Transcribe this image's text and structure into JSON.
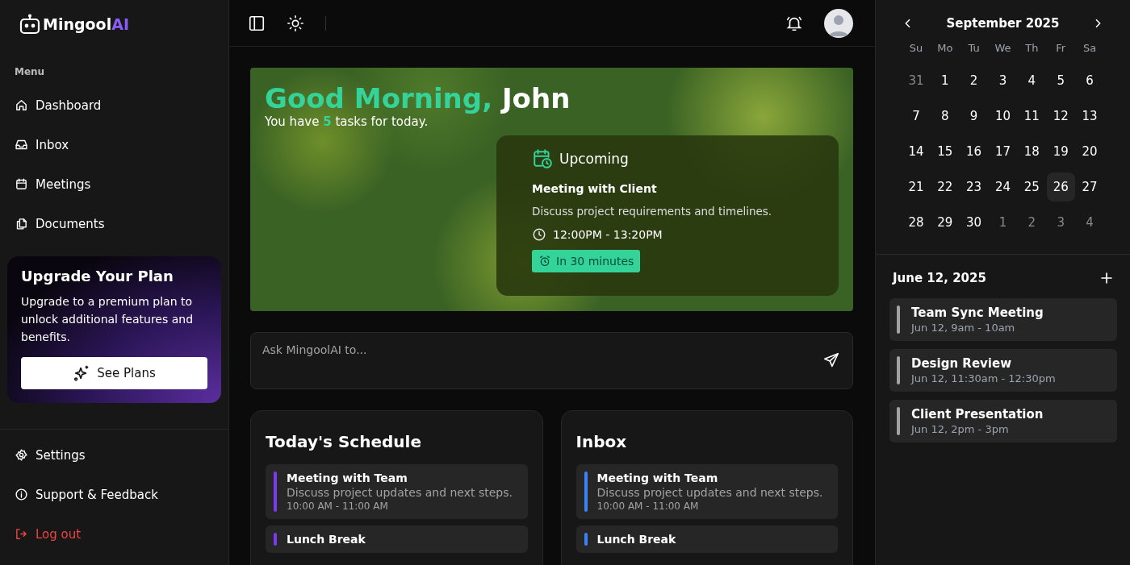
{
  "brand": {
    "name": "Mingool",
    "accent": "AI"
  },
  "sidebar": {
    "menu_label": "Menu",
    "items": [
      {
        "label": "Dashboard"
      },
      {
        "label": "Inbox"
      },
      {
        "label": "Meetings"
      },
      {
        "label": "Documents"
      }
    ],
    "upgrade": {
      "title": "Upgrade Your Plan",
      "text": "Upgrade to a premium plan to unlock additional features and benefits.",
      "button": "See Plans"
    },
    "footer_items": [
      {
        "label": "Settings",
        "kind": "normal"
      },
      {
        "label": "Support & Feedback",
        "kind": "normal"
      },
      {
        "label": "Log out",
        "kind": "danger"
      }
    ]
  },
  "hero": {
    "greeting": "Good Morning,",
    "name": "John",
    "subtitle": "You have **5** tasks for today.",
    "upcoming": {
      "heading": "Upcoming",
      "title": "Meeting with Client",
      "description": "Discuss project requirements and timelines.",
      "time": "12:00PM - 13:20PM",
      "badge": "In 30 minutes"
    }
  },
  "ask": {
    "placeholder": "Ask MingoolAI to..."
  },
  "panels": [
    {
      "title": "Today's Schedule",
      "items": [
        {
          "title": "Meeting with Team",
          "description": "Discuss project updates and next steps.",
          "time": "10:00 AM - 11:00 AM",
          "color": "#7c3aed"
        },
        {
          "title": "Lunch Break",
          "color": "#7c3aed"
        }
      ]
    },
    {
      "title": "Inbox",
      "items": [
        {
          "title": "Meeting with Team",
          "description": "Discuss project updates and next steps.",
          "time": "10:00 AM - 11:00 AM",
          "color": "#3b82f6"
        },
        {
          "title": "Lunch Break",
          "color": "#3b82f6"
        }
      ]
    }
  ],
  "calendar": {
    "month": "September 2025",
    "weekdays": [
      "Su",
      "Mo",
      "Tu",
      "We",
      "Th",
      "Fr",
      "Sa"
    ],
    "weeks": [
      [
        {
          "label": "31",
          "muted": true,
          "selected": false
        },
        {
          "label": "1",
          "muted": false,
          "selected": false
        },
        {
          "label": "2",
          "muted": false,
          "selected": false
        },
        {
          "label": "3",
          "muted": false,
          "selected": false
        },
        {
          "label": "4",
          "muted": false,
          "selected": false
        },
        {
          "label": "5",
          "muted": false,
          "selected": false
        },
        {
          "label": "6",
          "muted": false,
          "selected": false
        }
      ],
      [
        {
          "label": "7",
          "muted": false,
          "selected": false
        },
        {
          "label": "8",
          "muted": false,
          "selected": false
        },
        {
          "label": "9",
          "muted": false,
          "selected": false
        },
        {
          "label": "10",
          "muted": false,
          "selected": false
        },
        {
          "label": "11",
          "muted": false,
          "selected": false
        },
        {
          "label": "12",
          "muted": false,
          "selected": false
        },
        {
          "label": "13",
          "muted": false,
          "selected": false
        }
      ],
      [
        {
          "label": "14",
          "muted": false,
          "selected": false
        },
        {
          "label": "15",
          "muted": false,
          "selected": false
        },
        {
          "label": "16",
          "muted": false,
          "selected": false
        },
        {
          "label": "17",
          "muted": false,
          "selected": false
        },
        {
          "label": "18",
          "muted": false,
          "selected": false
        },
        {
          "label": "19",
          "muted": false,
          "selected": false
        },
        {
          "label": "20",
          "muted": false,
          "selected": false
        }
      ],
      [
        {
          "label": "21",
          "muted": false,
          "selected": false
        },
        {
          "label": "22",
          "muted": false,
          "selected": false
        },
        {
          "label": "23",
          "muted": false,
          "selected": false
        },
        {
          "label": "24",
          "muted": false,
          "selected": false
        },
        {
          "label": "25",
          "muted": false,
          "selected": false
        },
        {
          "label": "26",
          "muted": false,
          "selected": true
        },
        {
          "label": "27",
          "muted": false,
          "selected": false
        }
      ],
      [
        {
          "label": "28",
          "muted": false,
          "selected": false
        },
        {
          "label": "29",
          "muted": false,
          "selected": false
        },
        {
          "label": "30",
          "muted": false,
          "selected": false
        },
        {
          "label": "1",
          "muted": true,
          "selected": false
        },
        {
          "label": "2",
          "muted": true,
          "selected": false
        },
        {
          "label": "3",
          "muted": true,
          "selected": false
        },
        {
          "label": "4",
          "muted": true,
          "selected": false
        }
      ]
    ]
  },
  "agenda": {
    "date": "June 12, 2025",
    "events": [
      {
        "title": "Team Sync Meeting",
        "time": "Jun 12, 9am - 10am",
        "color": "#a3a3a3"
      },
      {
        "title": "Design Review",
        "time": "Jun 12, 11:30am - 12:30pm",
        "color": "#a3a3a3"
      },
      {
        "title": "Client Presentation",
        "time": "Jun 12, 2pm - 3pm",
        "color": "#a3a3a3"
      }
    ]
  }
}
